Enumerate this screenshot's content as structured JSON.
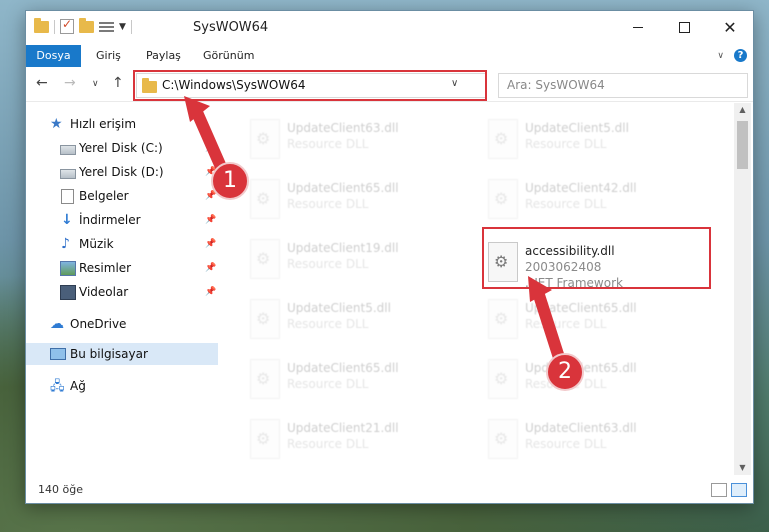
{
  "window": {
    "title": "SysWOW64"
  },
  "ribbon": {
    "tabs": [
      "Dosya",
      "Giriş",
      "Paylaş",
      "Görünüm"
    ]
  },
  "navbar": {
    "address": "C:\\Windows\\SysWOW64",
    "search_placeholder": "Ara: SysWOW64"
  },
  "sidebar": {
    "quick_access": "Hızlı erişim",
    "items": [
      {
        "label": "Yerel Disk (C:)",
        "icon": "drive-icon",
        "pinned": true
      },
      {
        "label": "Yerel Disk (D:)",
        "icon": "drive-icon",
        "pinned": true
      },
      {
        "label": "Belgeler",
        "icon": "document-icon",
        "pinned": true
      },
      {
        "label": "İndirmeler",
        "icon": "download-icon",
        "pinned": true
      },
      {
        "label": "Müzik",
        "icon": "music-icon",
        "pinned": true
      },
      {
        "label": "Resimler",
        "icon": "pictures-icon",
        "pinned": true
      },
      {
        "label": "Videolar",
        "icon": "video-icon",
        "pinned": true
      }
    ],
    "onedrive": "OneDrive",
    "this_pc": "Bu bilgisayar",
    "network": "Ağ"
  },
  "files": {
    "left_column": [
      {
        "name": "UpdateClient63.dll",
        "type": "Resource DLL"
      },
      {
        "name": "UpdateClient65.dll",
        "type": "Resource DLL"
      },
      {
        "name": "UpdateClient19.dll",
        "type": "Resource DLL"
      },
      {
        "name": "UpdateClient5.dll",
        "type": "Resource DLL"
      },
      {
        "name": "UpdateClient65.dll",
        "type": "Resource DLL"
      },
      {
        "name": "UpdateClient21.dll",
        "type": "Resource DLL"
      }
    ],
    "right_column": [
      {
        "name": "UpdateClient5.dll",
        "type": "Resource DLL"
      },
      {
        "name": "UpdateClient42.dll",
        "type": "Resource DLL"
      },
      {
        "name": "UpdateClient65.dll",
        "type": "Resource DLL"
      },
      {
        "name": "UpdateClient65.dll",
        "type": "Resource DLL"
      },
      {
        "name": "UpdateClient63.dll",
        "type": "Resource DLL"
      }
    ],
    "highlighted": {
      "name": "accessibility.dll",
      "version": "2003062408",
      "description": ".NET Framework"
    }
  },
  "status": {
    "item_count": "140 öğe"
  },
  "annotations": {
    "step1": "1",
    "step2": "2",
    "color": "#d9343b"
  }
}
